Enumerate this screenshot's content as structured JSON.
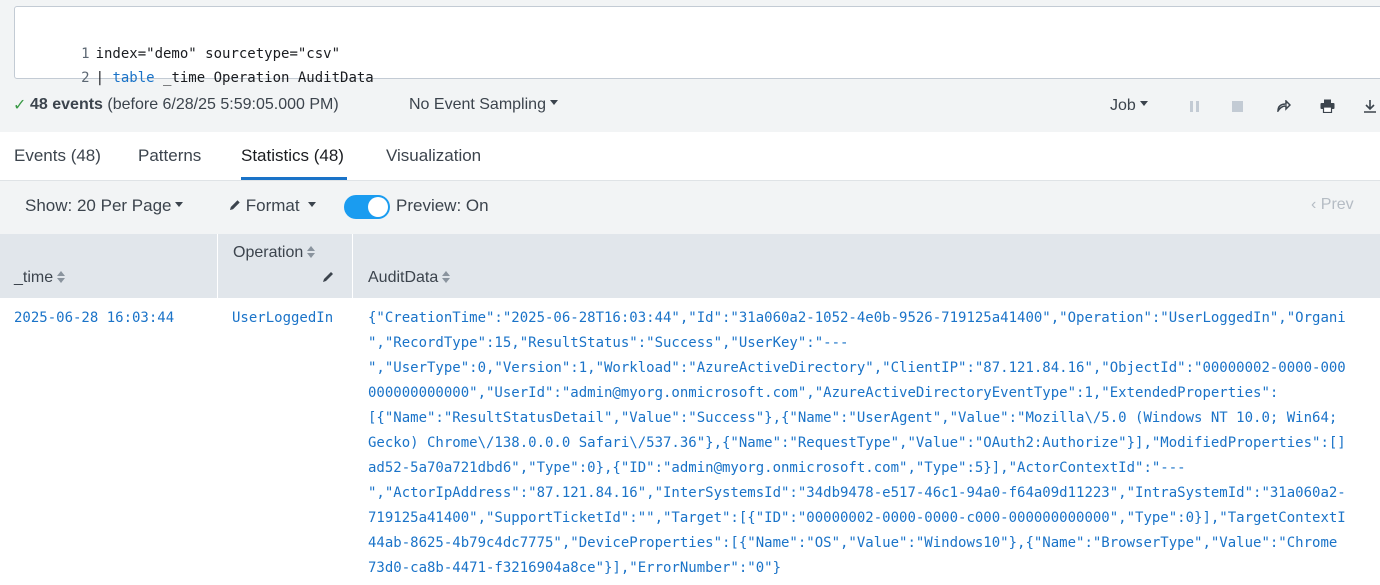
{
  "editor": {
    "lines": [
      {
        "num": "1",
        "text": "index=\"demo\" sourcetype=\"csv\""
      },
      {
        "num": "2",
        "pipe": "| ",
        "keyword": "table",
        "rest": " _time Operation AuditData"
      }
    ]
  },
  "status": {
    "events_count": "48 events",
    "events_detail": "(before 6/28/25 5:59:05.000 PM)",
    "sampling": "No Event Sampling",
    "job": "Job"
  },
  "tabs": [
    {
      "label": "Events (48)"
    },
    {
      "label": "Patterns"
    },
    {
      "label": "Statistics (48)"
    },
    {
      "label": "Visualization"
    }
  ],
  "controls": {
    "show": "Show: 20 Per Page",
    "format": "Format",
    "preview": "Preview: On",
    "preview_on": true,
    "prev": "Prev"
  },
  "columns": {
    "time": "_time",
    "operation": "Operation",
    "audit": "AuditData"
  },
  "rows": [
    {
      "time": "2025-06-28 16:03:44",
      "operation": "UserLoggedIn",
      "audit_lines": [
        "{\"CreationTime\":\"2025-06-28T16:03:44\",\"Id\":\"31a060a2-1052-4e0b-9526-719125a41400\",\"Operation\":\"UserLoggedIn\",\"Organi",
        "\",\"RecordType\":15,\"ResultStatus\":\"Success\",\"UserKey\":\"---",
        "\",\"UserType\":0,\"Version\":1,\"Workload\":\"AzureActiveDirectory\",\"ClientIP\":\"87.121.84.16\",\"ObjectId\":\"00000002-0000-000",
        "000000000000\",\"UserId\":\"admin@myorg.onmicrosoft.com\",\"AzureActiveDirectoryEventType\":1,\"ExtendedProperties\":",
        "[{\"Name\":\"ResultStatusDetail\",\"Value\":\"Success\"},{\"Name\":\"UserAgent\",\"Value\":\"Mozilla\\/5.0 (Windows NT 10.0; Win64;",
        "Gecko) Chrome\\/138.0.0.0 Safari\\/537.36\"},{\"Name\":\"RequestType\",\"Value\":\"OAuth2:Authorize\"}],\"ModifiedProperties\":[]",
        "ad52-5a70a721dbd6\",\"Type\":0},{\"ID\":\"admin@myorg.onmicrosoft.com\",\"Type\":5}],\"ActorContextId\":\"---",
        "\",\"ActorIpAddress\":\"87.121.84.16\",\"InterSystemsId\":\"34db9478-e517-46c1-94a0-f64a09d11223\",\"IntraSystemId\":\"31a060a2-",
        "719125a41400\",\"SupportTicketId\":\"\",\"Target\":[{\"ID\":\"00000002-0000-0000-c000-000000000000\",\"Type\":0}],\"TargetContextI",
        "44ab-8625-4b79c4dc7775\",\"DeviceProperties\":[{\"Name\":\"OS\",\"Value\":\"Windows10\"},{\"Name\":\"BrowserType\",\"Value\":\"Chrome",
        "73d0-ca8b-4471-f3216904a8ce\"}],\"ErrorNumber\":\"0\"}"
      ]
    }
  ],
  "colors": {
    "accent": "#1a73c8",
    "toggle_on": "#1a9cf0",
    "success_check": "#3a9a46"
  },
  "icons": [
    "check-icon",
    "chevron-down-icon",
    "pause-icon",
    "stop-icon",
    "share-icon",
    "print-icon",
    "export-icon",
    "pencil-icon",
    "sort-icon",
    "chevron-left-icon"
  ]
}
